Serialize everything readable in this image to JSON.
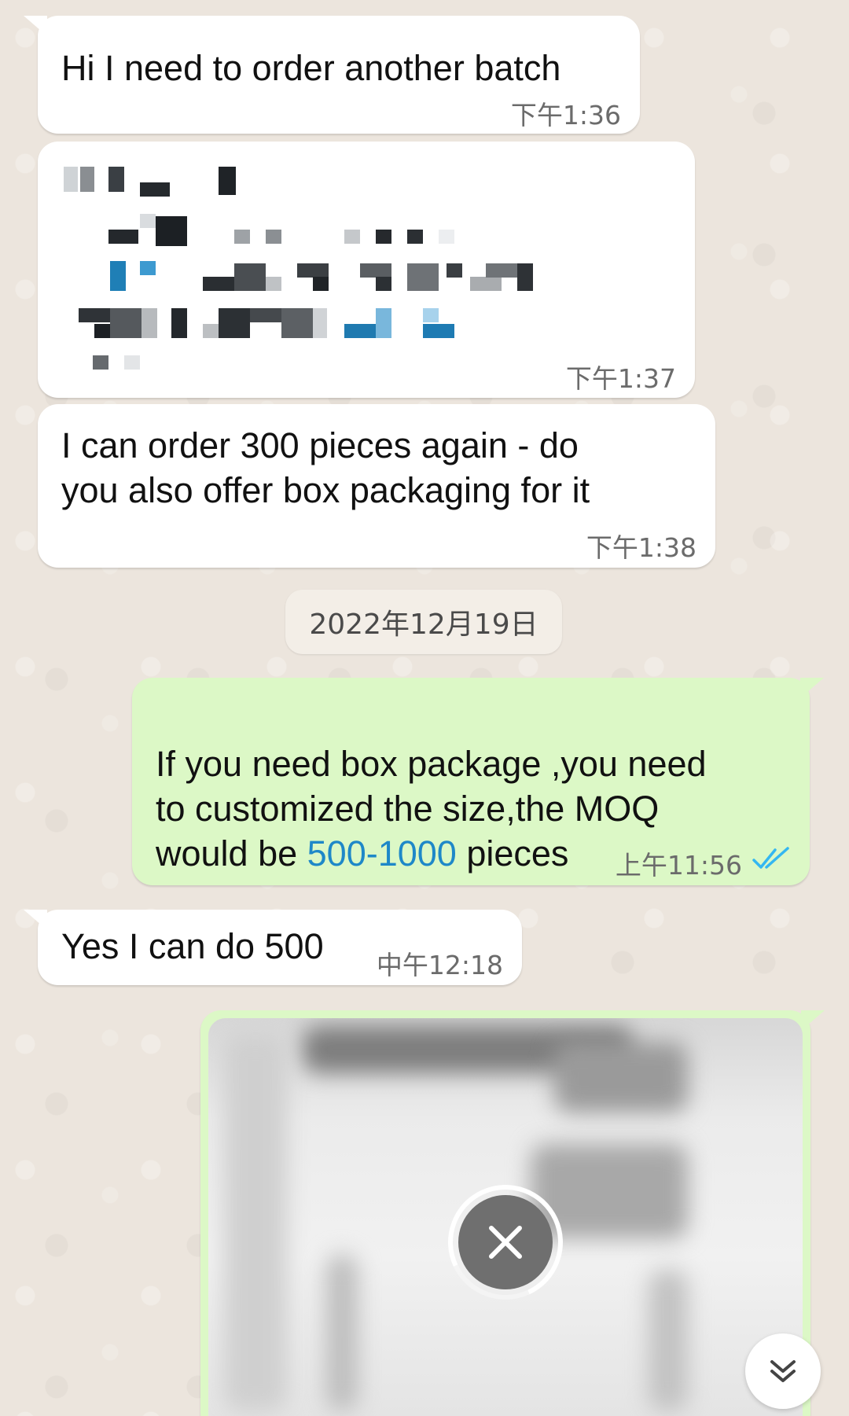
{
  "messages": [
    {
      "text": "Hi I need to order another batch",
      "time": "下午1:36",
      "direction": "incoming"
    },
    {
      "text": "",
      "time": "下午1:37",
      "direction": "incoming",
      "content": "pixelated-redacted"
    },
    {
      "text": "I can order 300 pieces again - do\nyou also offer box packaging for it",
      "time": "下午1:38",
      "direction": "incoming"
    },
    {
      "text_before": "If you need box package ,you need\nto customized the size,the MOQ\nwould be ",
      "link": "500-1000",
      "text_after": " pieces",
      "time": "上午11:56",
      "direction": "outgoing",
      "status": "read"
    },
    {
      "text": "Yes I can do 500",
      "time": "中午12:18",
      "direction": "incoming"
    },
    {
      "direction": "outgoing",
      "content": "image-uploading"
    }
  ],
  "date_divider": "2022年12月19日",
  "icons": {
    "read_receipt": "double-check-icon",
    "cancel_upload": "close-icon",
    "scroll_down": "double-chevron-down-icon"
  },
  "colors": {
    "chat_background": "#ECE5DD",
    "incoming_bubble": "#FFFFFF",
    "outgoing_bubble": "#DCF8C6",
    "link": "#1E88C8",
    "read_tick": "#34B7F1"
  }
}
